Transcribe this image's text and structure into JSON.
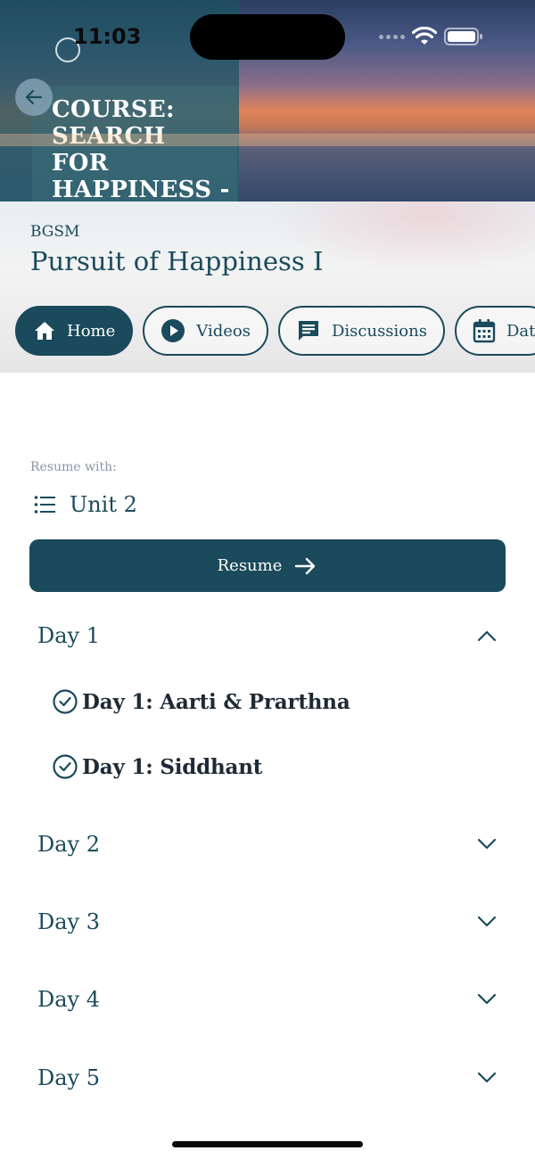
{
  "status_bar": {
    "time": "11:03"
  },
  "hero": {
    "title": "COURSE: SEARCH FOR HAPPINESS - I"
  },
  "course": {
    "org": "BGSM",
    "name": "Pursuit of Happiness I"
  },
  "tabs": [
    {
      "label": "Home",
      "icon": "home-icon",
      "active": true
    },
    {
      "label": "Videos",
      "icon": "play-icon",
      "active": false
    },
    {
      "label": "Discussions",
      "icon": "chat-icon",
      "active": false
    },
    {
      "label": "Dat",
      "icon": "calendar-icon",
      "active": false
    }
  ],
  "resume": {
    "label": "Resume with:",
    "unit": "Unit 2",
    "button_label": "Resume"
  },
  "days": [
    {
      "label": "Day 1",
      "expanded": true,
      "lessons": [
        {
          "title": "Day 1: Aarti & Prarthna",
          "completed": true
        },
        {
          "title": "Day 1: Siddhant",
          "completed": true
        }
      ]
    },
    {
      "label": "Day 2",
      "expanded": false
    },
    {
      "label": "Day 3",
      "expanded": false
    },
    {
      "label": "Day 4",
      "expanded": false
    },
    {
      "label": "Day 5",
      "expanded": false
    }
  ],
  "colors": {
    "primary": "#1a4a5c",
    "muted": "#8a96a5",
    "lesson_text": "#1e2a35"
  }
}
